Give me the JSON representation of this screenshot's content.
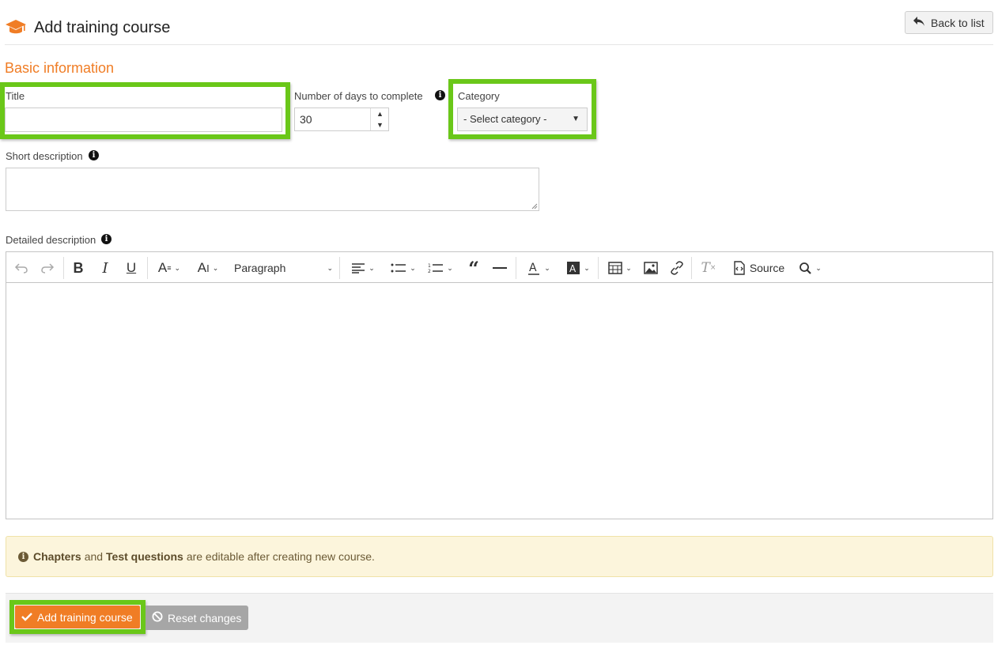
{
  "header": {
    "title": "Add training course",
    "icon": "graduation-cap-icon",
    "back_label": "Back to list",
    "accent_color": "#f07d25"
  },
  "section": {
    "title": "Basic information"
  },
  "form": {
    "title_label": "Title",
    "title_value": "",
    "days_label": "Number of days to complete",
    "days_value": "30",
    "category_label": "Category",
    "category_value": "- Select category -",
    "short_label": "Short description",
    "short_value": "",
    "detailed_label": "Detailed description"
  },
  "editor": {
    "paragraph_label": "Paragraph",
    "source_label": "Source",
    "toolbar_icons": [
      "undo-icon",
      "redo-icon",
      "bold-icon",
      "italic-icon",
      "underline-icon",
      "font-size-icon",
      "font-family-icon",
      "heading-dropdown",
      "align-icon",
      "bulleted-list-icon",
      "numbered-list-icon",
      "quote-icon",
      "horizontal-line-icon",
      "font-color-icon",
      "font-background-icon",
      "table-icon",
      "image-icon",
      "link-icon",
      "remove-format-icon",
      "source-icon",
      "find-replace-icon"
    ]
  },
  "alert": {
    "chapters": "Chapters",
    "and": "and",
    "test_questions": "Test questions",
    "rest": "are editable after creating new course."
  },
  "footer": {
    "add_label": "Add training course",
    "reset_label": "Reset changes"
  },
  "highlight_color": "#6ac719"
}
